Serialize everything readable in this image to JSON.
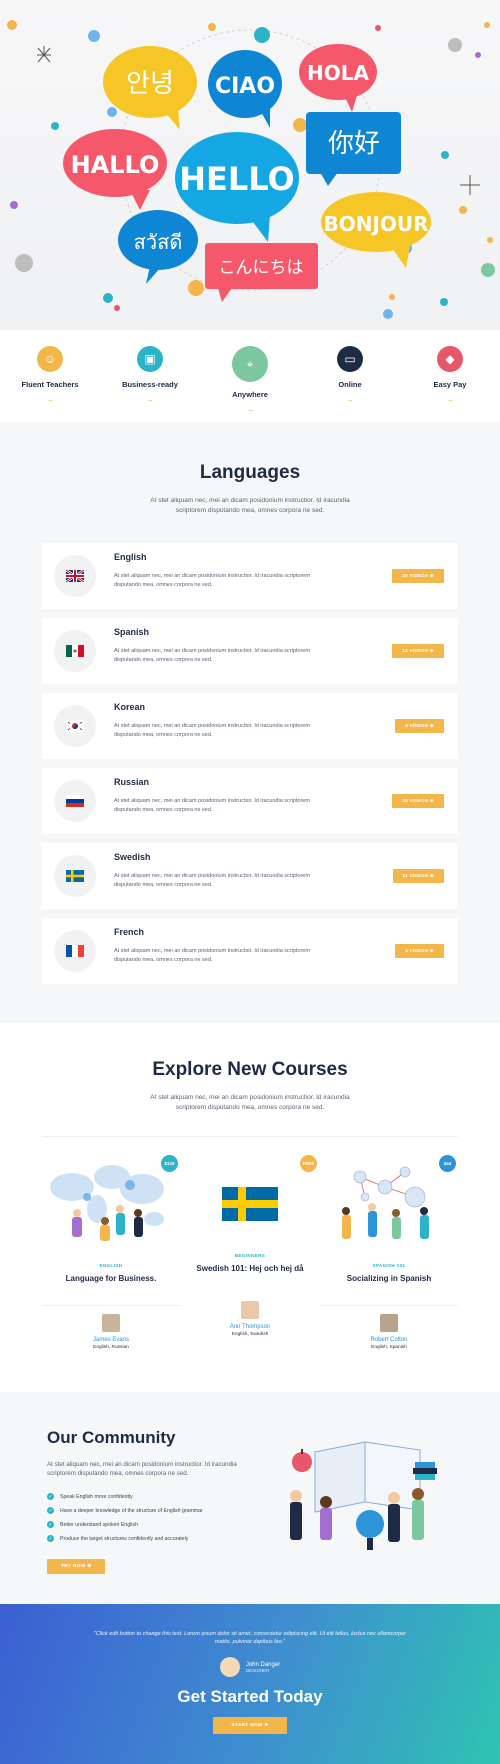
{
  "hero": {
    "bubbles": [
      "안녕",
      "CIAO",
      "HOLA",
      "你好",
      "HALLO",
      "HELLO",
      "BONJOUR",
      "สวัสดี",
      "こんにちは"
    ]
  },
  "features": [
    {
      "label": "Fluent Teachers",
      "color": "#f2b64b",
      "icon": "teacher-icon"
    },
    {
      "label": "Business-ready",
      "color": "#2bb3c8",
      "icon": "briefcase-icon"
    },
    {
      "label": "Anywhere",
      "color": "#7cc6a0",
      "icon": "location-pin-icon"
    },
    {
      "label": "Online",
      "color": "#1f2a44",
      "icon": "monitor-icon"
    },
    {
      "label": "Easy Pay",
      "color": "#e8566a",
      "icon": "pay-icon"
    }
  ],
  "languages": {
    "title": "Languages",
    "subtitle": "At stet aliquam nec, mei an dicam posidonium instructior. Id iracundia scriptorem disputando mea, omnes corpora ne sed.",
    "items": [
      {
        "name": "English",
        "desc": "At stet aliquam nec, mei an dicam posidonium instructior. Id iracundia scriptorem disputando mea, omnes corpora ne sed.",
        "videos": "20 VIDEOS"
      },
      {
        "name": "Spanish",
        "desc": "At stet aliquam nec, mei an dicam posidonium instructior. Id iracundia scriptorem disputando mea, omnes corpora ne sed.",
        "videos": "12 VIDEOS"
      },
      {
        "name": "Korean",
        "desc": "At stet aliquam nec, mei an dicam posidonium instructior. Id iracundia scriptorem disputando mea, omnes corpora ne sed.",
        "videos": "4 VIDEOS"
      },
      {
        "name": "Russian",
        "desc": "At stet aliquam nec, mei an dicam posidonium instructior. Id iracundia scriptorem disputando mea, omnes corpora ne sed.",
        "videos": "28 VIDEOS"
      },
      {
        "name": "Swedish",
        "desc": "At stet aliquam nec, mei an dicam posidonium instructior. Id iracundia scriptorem disputando mea, omnes corpora ne sed.",
        "videos": "11 VIDEOS"
      },
      {
        "name": "French",
        "desc": "At stet aliquam nec, mei an dicam posidonium instructior. Id iracundia scriptorem disputando mea, omnes corpora ne sed.",
        "videos": "4 VIDEOS"
      }
    ]
  },
  "courses": {
    "title": "Explore New Courses",
    "subtitle": "At stet aliquam nec, mei an dicam posidonium instructior. Id iracundia scriptorem disputando mea, omnes corpora ne sed.",
    "items": [
      {
        "price": "$120",
        "price_color": "#2bb3c8",
        "level": "ENGLISH",
        "title": "Language for Business.",
        "teacher": "James Evans",
        "teacher_langs": "English, Russian"
      },
      {
        "price": "FREE",
        "price_color": "#f2b64b",
        "level": "BEGINNERS",
        "title": "Swedish 101: Hej och hej då",
        "teacher": "Ann Thompson",
        "teacher_langs": "English, Swedish"
      },
      {
        "price": "$44",
        "price_color": "#2b95d8",
        "level": "SPANISH 101",
        "title": "Socializing in Spanish",
        "teacher": "Robert Colton",
        "teacher_langs": "English, Spanish"
      }
    ]
  },
  "community": {
    "title": "Our Community",
    "subtitle": "At stet aliquam nec, mei an dicam posidonium instructior. Id iracundia scriptorem disputando mea, omnes corpora ne sed.",
    "checks": [
      "Speak English more confidently",
      "Have a deeper knowledge of the structure of English grammar",
      "Better understand spoken English",
      "Produce the target structures confidently and accurately"
    ],
    "button": "TRY NOW"
  },
  "cta": {
    "quote": "\"Click edit button to change this text. Lorem ipsum dolor sit amet, consectetur adipiscing elit. Ut elit tellus, luctus nec ullamcorper mattis, pulvinar dapibus leo.\"",
    "author": "John Danger",
    "role": "DESIGNER",
    "title": "Get Started Today",
    "button": "START NOW"
  }
}
